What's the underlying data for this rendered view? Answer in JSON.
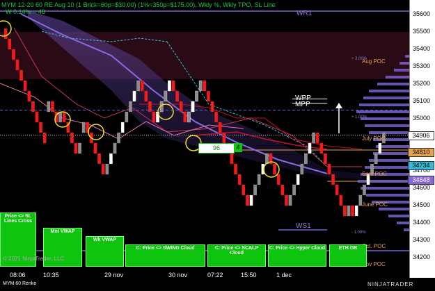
{
  "header": {
    "line1": "MYM 12-20 60 RE Aug 10 (1 Brick=60p=$30.00) (1%=350p=$175.00), Wkly %, Wkly TPO, SL Line",
    "line2": "W 0.14% = 48"
  },
  "levels": {
    "wr1": "WR1",
    "ws1": "WS1",
    "wpp": "WPP",
    "mpp": "MPP",
    "aug_poc": "Aug POC",
    "july_poc": "July POC",
    "sept_poc": "Sept POC",
    "june_poc": "June POC",
    "oct_poc": "Oct. POC",
    "nov_poc": "Nov POC",
    "pct_2": "+ 2.00%",
    "pct_1": "+ 1.00%",
    "pct_m1": "- 1.00%"
  },
  "axis": {
    "ticks": [
      "35600",
      "35500",
      "35400",
      "35300",
      "35200",
      "35100",
      "35000",
      "34900",
      "34800",
      "34700",
      "34600",
      "34500",
      "34400",
      "34300",
      "34200"
    ],
    "price_tags": [
      {
        "value": "34906",
        "bg": "#ffffff",
        "fg": "#000000"
      },
      {
        "value": "34810",
        "bg": "#e8a24a",
        "fg": "#000000"
      },
      {
        "value": "34734",
        "bg": "#38b8d8",
        "fg": "#000000"
      },
      {
        "value": "34648",
        "bg": "#8a66d8",
        "fg": "#ffffff"
      }
    ]
  },
  "xaxis": {
    "labels": [
      "08:06",
      "10:35",
      "29 nov",
      "30 nov",
      "07:22",
      "15:50",
      "1 dec"
    ]
  },
  "buttons": {
    "price_sl": "Price <> SL Lines Cross",
    "mnt_vwap": "Mnt VWAP",
    "wk_vwap": "Wk VWAP",
    "swing": "C: Price <> SWING Cloud",
    "scalp": "C: Price <> SCALP Cloud",
    "hyper": "C: Price <> Hyper Cloud",
    "eth_or": "ETH OR"
  },
  "brick_counter": {
    "left": "96",
    "right": "4"
  },
  "footer": {
    "copyright": "© 2021 NinjaTrader, LLC",
    "instrument": "MYM 60 Renko",
    "brand": "NINJATRADER"
  },
  "chart_data": {
    "type": "renko",
    "ylim": [
      34150,
      35650
    ],
    "bricks": [
      35460,
      35400,
      35340,
      35280,
      35220,
      35160,
      35100,
      35040,
      34980,
      34920,
      34860,
      35100,
      35040,
      34980,
      35040,
      34980,
      34920,
      34860,
      34800,
      34860,
      34980,
      34920,
      34860,
      34800,
      34740,
      34680,
      34740,
      34800,
      34860,
      34920,
      34980,
      35040,
      35100,
      35160,
      35220,
      35160,
      35100,
      35040,
      34980,
      35040,
      35100,
      35160,
      35220,
      35160,
      35100,
      35040,
      34980,
      35040,
      35100,
      35160,
      35220,
      35160,
      35100,
      35040,
      34980,
      34920,
      34860,
      34800,
      34740,
      34680,
      34620,
      34560,
      34500,
      34560,
      34620,
      34680,
      34740,
      34800,
      34740,
      34680,
      34620,
      34560,
      34500,
      34560,
      34620,
      34680,
      34740,
      34800,
      34860,
      34920,
      34860,
      34800,
      34740,
      34680,
      34620,
      34560,
      34500,
      34440,
      34500,
      34440,
      34500,
      34560,
      34620,
      34680,
      34740,
      34800,
      34860,
      34920
    ],
    "wr1": 35620,
    "ws1": 34360,
    "wpp": 35090,
    "mpp": 35050,
    "aug_poc": 35310,
    "july_poc": 34820,
    "sept_poc": 34640,
    "june_poc": 34500,
    "oct_poc": 34230,
    "nov_poc": 34170,
    "last_price": 34906
  }
}
